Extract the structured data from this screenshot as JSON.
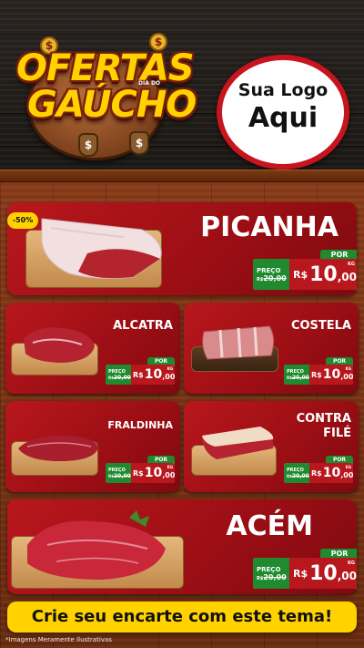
{
  "header": {
    "title_line1": "OFERTAS",
    "title_line2": "GAÚCHO",
    "title_subtitle": "DIA DO",
    "logo_line1": "Sua Logo",
    "logo_line2": "Aqui",
    "coin_symbol": "$"
  },
  "discount_badge": "-50%",
  "price_labels": {
    "por": "POR",
    "preco": "PREÇO",
    "rs_small": "R$",
    "old_value": "20,00",
    "rs": "R$",
    "new_int": "10",
    "new_dec": ",00",
    "kg": "KG"
  },
  "products": [
    {
      "name": "PICANHA"
    },
    {
      "name": "ALCATRA"
    },
    {
      "name": "COSTELA"
    },
    {
      "name": "FRALDINHA"
    },
    {
      "name": "CONTRA"
    },
    {
      "name": "FILÉ"
    },
    {
      "name": "ACÉM"
    }
  ],
  "cta": "Crie seu encarte com este tema!",
  "disclaimer": "*Imagens Meramente Ilustrativas",
  "colors": {
    "red": "#b8171d",
    "green": "#1f8a2e",
    "yellow": "#ffd200",
    "wood": "#7a3414"
  }
}
